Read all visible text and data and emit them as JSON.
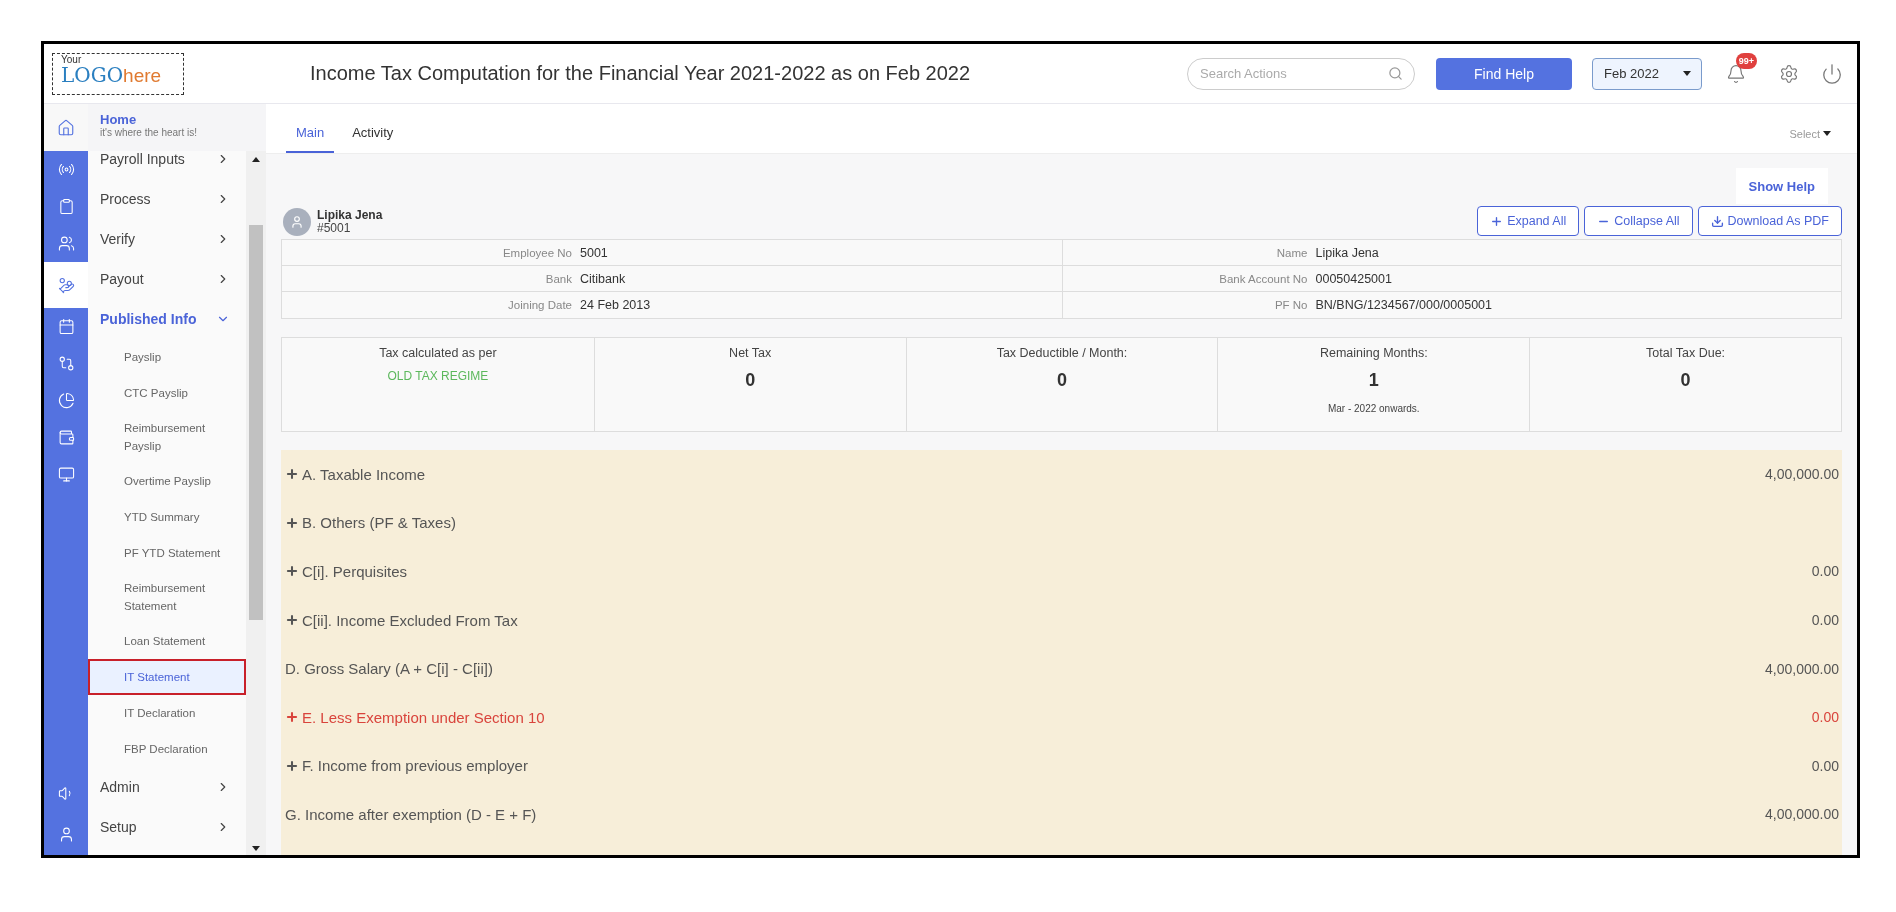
{
  "logo": {
    "top": "Your",
    "brand": "LOGO",
    "suffix": "here"
  },
  "header": {
    "title": "Income Tax Computation for the Financial Year 2021-2022 as on Feb 2022",
    "search": {
      "placeholder": "Search Actions"
    },
    "help_button": "Find Help",
    "month": "Feb 2022",
    "notifications": "99+"
  },
  "rail": [
    {
      "selected": false
    },
    {
      "selected": false
    },
    {
      "selected": false
    },
    {
      "selected": true
    },
    {
      "selected": false
    },
    {
      "selected": false
    },
    {
      "selected": false
    },
    {
      "selected": false
    },
    {
      "selected": false
    },
    {
      "selected": false
    },
    {
      "selected": false
    }
  ],
  "home": {
    "title": "Home",
    "subtitle": "it's where the heart is!"
  },
  "sidebar": {
    "items": [
      {
        "label": "Payroll Inputs",
        "expanded": false
      },
      {
        "label": "Process",
        "expanded": false
      },
      {
        "label": "Verify",
        "expanded": false
      },
      {
        "label": "Payout",
        "expanded": false
      },
      {
        "label": "Published Info",
        "expanded": true,
        "children": [
          {
            "label": "Payslip",
            "selected": false
          },
          {
            "label": "CTC Payslip",
            "selected": false
          },
          {
            "label": "Reimbursement Payslip",
            "selected": false
          },
          {
            "label": "Overtime Payslip",
            "selected": false
          },
          {
            "label": "YTD Summary",
            "selected": false
          },
          {
            "label": "PF YTD Statement",
            "selected": false
          },
          {
            "label": "Reimbursement Statement",
            "selected": false
          },
          {
            "label": "Loan Statement",
            "selected": false
          },
          {
            "label": "IT Statement",
            "selected": true
          },
          {
            "label": "IT Declaration",
            "selected": false
          },
          {
            "label": "FBP Declaration",
            "selected": false
          }
        ]
      },
      {
        "label": "Admin",
        "expanded": false
      },
      {
        "label": "Setup",
        "expanded": false
      }
    ]
  },
  "tabs": [
    {
      "label": "Main",
      "selected": true
    },
    {
      "label": "Activity",
      "selected": false
    }
  ],
  "select_menu": "Select",
  "show_help": "Show Help",
  "employee": {
    "name": "Lipika Jena",
    "code": "#5001"
  },
  "actions": [
    {
      "kind": "expand",
      "label": "Expand All"
    },
    {
      "kind": "collapse",
      "label": "Collapse All"
    },
    {
      "kind": "download",
      "label": "Download As PDF"
    }
  ],
  "info": [
    [
      {
        "label": "Employee No",
        "value": "5001"
      },
      {
        "label": "Name",
        "value": "Lipika Jena"
      }
    ],
    [
      {
        "label": "Bank",
        "value": "Citibank"
      },
      {
        "label": "Bank Account No",
        "value": "00050425001"
      }
    ],
    [
      {
        "label": "Joining Date",
        "value": "24 Feb 2013"
      },
      {
        "label": "PF No",
        "value": "BN/BNG/1234567/000/0005001"
      }
    ]
  ],
  "summary": [
    {
      "label": "Tax calculated as per",
      "regime": "OLD TAX REGIME"
    },
    {
      "label": "Net Tax",
      "value": "0"
    },
    {
      "label": "Tax Deductible / Month:",
      "value": "0"
    },
    {
      "label": "Remaining Months:",
      "value": "1",
      "note": "Mar - 2022 onwards."
    },
    {
      "label": "Total Tax Due:",
      "value": "0"
    }
  ],
  "rows": [
    {
      "kind": "expandable",
      "label": "A. Taxable Income",
      "amount": "4,00,000.00",
      "alert": false
    },
    {
      "kind": "expandable",
      "label": "B. Others (PF & Taxes)",
      "alert": false
    },
    {
      "kind": "expandable",
      "label": "C[i]. Perquisites",
      "amount": "0.00",
      "alert": false
    },
    {
      "kind": "expandable",
      "label": "C[ii]. Income Excluded From Tax",
      "amount": "0.00",
      "alert": false
    },
    {
      "kind": "plain",
      "label": "D. Gross Salary (A + C[i] - C[ii])",
      "amount": "4,00,000.00",
      "alert": false
    },
    {
      "kind": "expandable",
      "label": "E. Less Exemption under Section 10",
      "amount": "0.00",
      "alert": true
    },
    {
      "kind": "expandable",
      "label": "F. Income from previous employer",
      "amount": "0.00",
      "alert": false
    },
    {
      "kind": "plain",
      "label": "G. Income after exemption (D - E + F)",
      "amount": "4,00,000.00",
      "alert": false
    }
  ]
}
